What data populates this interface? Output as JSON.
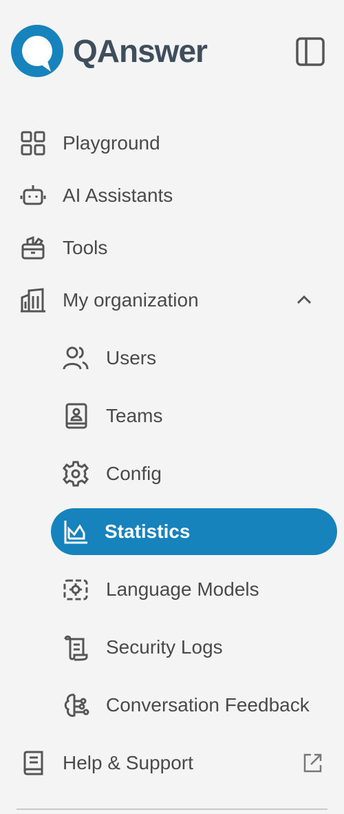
{
  "brand": {
    "name": "QAnswer",
    "color": "#1783bd"
  },
  "nav": {
    "playground": "Playground",
    "ai_assistants": "AI Assistants",
    "tools": "Tools",
    "my_organization": "My organization",
    "sub": {
      "users": "Users",
      "teams": "Teams",
      "config": "Config",
      "statistics": "Statistics",
      "language_models": "Language Models",
      "security_logs": "Security Logs",
      "conversation_feedback": "Conversation Feedback"
    },
    "help_support": "Help & Support",
    "active_item": "Statistics",
    "my_organization_expanded": true
  },
  "icons": {
    "sidebar_toggle": "sidebar-toggle-icon",
    "playground": "grid-icon",
    "ai_assistants": "robot-icon",
    "tools": "toolbox-icon",
    "my_organization": "building-icon",
    "users": "users-icon",
    "teams": "contact-book-icon",
    "config": "gear-icon",
    "statistics": "chart-icon",
    "language_models": "cpu-icon",
    "security_logs": "scroll-icon",
    "conversation_feedback": "brain-icon",
    "help_support": "book-icon",
    "external": "external-link-icon"
  }
}
